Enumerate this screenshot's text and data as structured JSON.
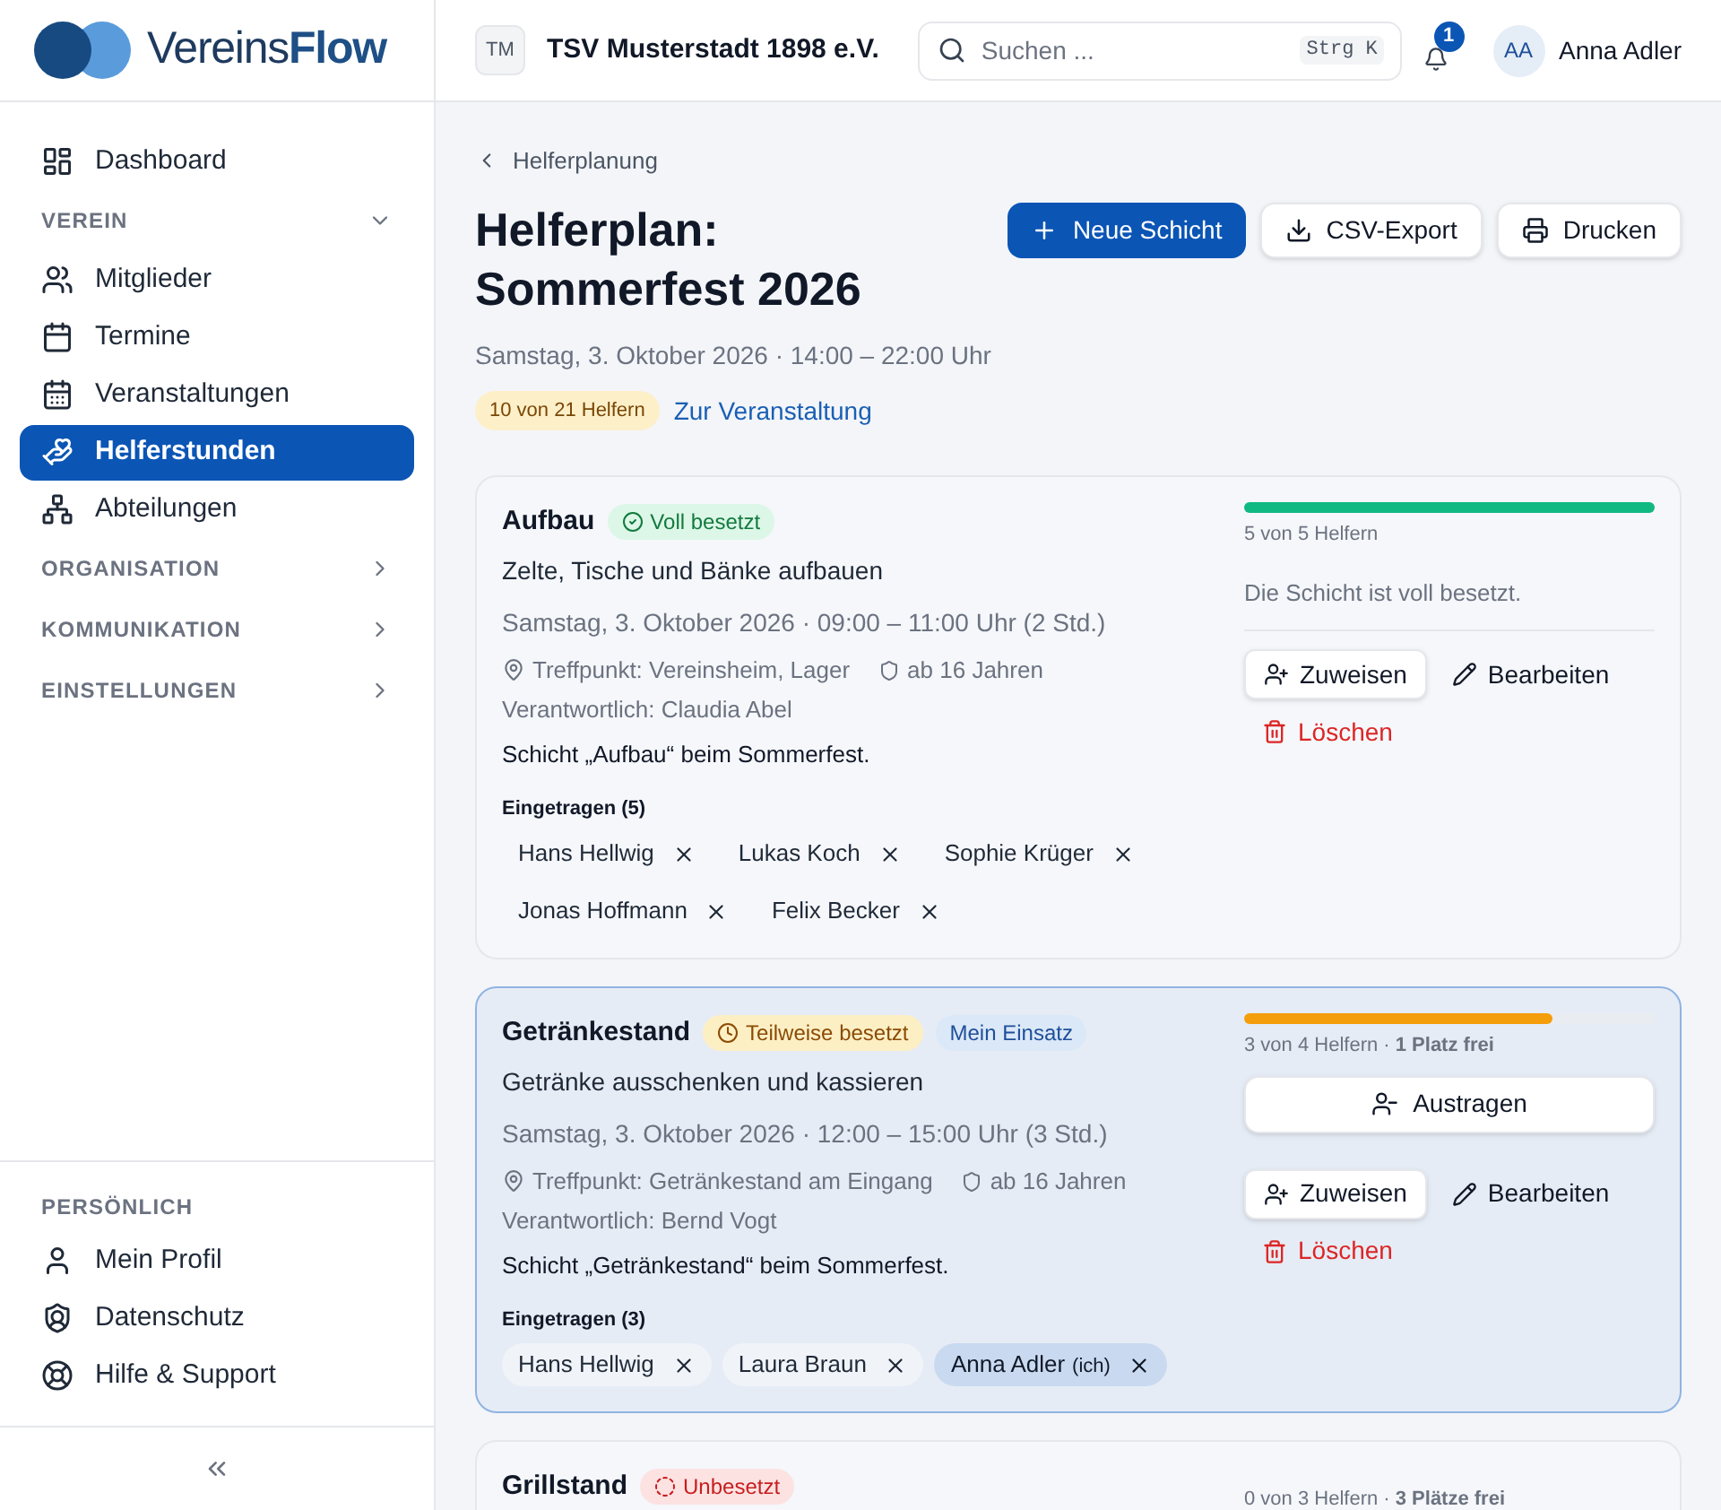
{
  "brand": {
    "name_light": "Vereins",
    "name_bold": "Flow"
  },
  "sidebar": {
    "items": [
      {
        "kind": "item",
        "label": "Dashboard",
        "selected": false
      },
      {
        "kind": "section",
        "label": "VEREIN",
        "expanded": true
      },
      {
        "kind": "item",
        "label": "Mitglieder",
        "selected": false
      },
      {
        "kind": "item",
        "label": "Termine",
        "selected": false
      },
      {
        "kind": "item",
        "label": "Veranstaltungen",
        "selected": false
      },
      {
        "kind": "item",
        "label": "Helferstunden",
        "selected": true
      },
      {
        "kind": "item",
        "label": "Abteilungen",
        "selected": false
      },
      {
        "kind": "section",
        "label": "ORGANISATION",
        "expanded": false
      },
      {
        "kind": "section",
        "label": "KOMMUNIKATION",
        "expanded": false
      },
      {
        "kind": "section",
        "label": "EINSTELLUNGEN",
        "expanded": false
      }
    ],
    "personal": {
      "heading": "PERSÖNLICH",
      "items": [
        {
          "label": "Mein Profil"
        },
        {
          "label": "Datenschutz"
        },
        {
          "label": "Hilfe & Support"
        }
      ]
    }
  },
  "header": {
    "org_initials": "TM",
    "org_name": "TSV Musterstadt 1898 e.V.",
    "search": {
      "placeholder": "Suchen ...",
      "shortcut": "Strg K"
    },
    "notifications": "1",
    "user": {
      "initials": "AA",
      "name": "Anna Adler"
    }
  },
  "page": {
    "breadcrumb": "Helferplanung",
    "title_line1": "Helferplan:",
    "title_line2": "Sommerfest 2026",
    "date": "Samstag, 3. Oktober 2026 · 14:00 – 22:00 Uhr",
    "count_badge": "10 von 21 Helfern",
    "event_link": "Zur Veranstaltung",
    "buttons": [
      {
        "kind": "primary",
        "label": "Neue Schicht"
      },
      {
        "kind": "export",
        "label": "CSV-Export"
      },
      {
        "kind": "print",
        "label": "Drucken"
      }
    ]
  },
  "shifts": [
    {
      "title": "Aufbau",
      "status": {
        "kind": "full",
        "label": "Voll besetzt"
      },
      "selected": false,
      "subtitle": "Zelte, Tische und Bänke aufbauen",
      "datetime": "Samstag, 3. Oktober 2026 · 09:00 – 11:00 Uhr (2 Std.)",
      "location": "Treffpunkt: Vereinsheim, Lager",
      "age": "ab 16 Jahren",
      "responsible": "Verantwortlich: Claudia Abel",
      "description": "Schicht „Aufbau“ beim Sommerfest.",
      "registered_label": "Eingetragen (5)",
      "members": [
        {
          "name": "Hans Hellwig",
          "self": false
        },
        {
          "name": "Lukas Koch",
          "self": false
        },
        {
          "name": "Sophie Krüger",
          "self": false
        },
        {
          "name": "Jonas Hoffmann",
          "self": false
        },
        {
          "name": "Felix Becker",
          "self": false
        }
      ],
      "progress": {
        "level": 1,
        "text": "5 von 5 Helfern"
      },
      "note": "Die Schicht ist voll besetzt.",
      "actions": [
        {
          "kind": "assign",
          "label": "Zuweisen"
        },
        {
          "kind": "edit",
          "label": "Bearbeiten"
        },
        {
          "kind": "delete",
          "label": "Löschen"
        }
      ]
    },
    {
      "title": "Getränkestand",
      "status": {
        "kind": "partial",
        "label": "Teilweise besetzt"
      },
      "tag": "Mein Einsatz",
      "selected": true,
      "subtitle": "Getränke ausschenken und kassieren",
      "datetime": "Samstag, 3. Oktober 2026 · 12:00 – 15:00 Uhr (3 Std.)",
      "location": "Treffpunkt: Getränkestand am Eingang",
      "age": "ab 16 Jahren",
      "responsible": "Verantwortlich: Bernd Vogt",
      "description": "Schicht „Getränkestand“ beim Sommerfest.",
      "registered_label": "Eingetragen (3)",
      "members": [
        {
          "name": "Hans Hellwig",
          "self": false
        },
        {
          "name": "Laura Braun",
          "self": false
        },
        {
          "name": "Anna Adler",
          "suffix": "(ich)",
          "self": true
        }
      ],
      "progress": {
        "level": 0.75,
        "text": "3 von 4 Helfern · **1 Platz frei**"
      },
      "actions": [
        {
          "kind": "unassign",
          "label": "Austragen"
        },
        {
          "kind": "assign",
          "label": "Zuweisen"
        },
        {
          "kind": "edit",
          "label": "Bearbeiten"
        },
        {
          "kind": "delete",
          "label": "Löschen"
        }
      ]
    },
    {
      "title": "Grillstand",
      "status": {
        "kind": "empty",
        "label": "Unbesetzt"
      },
      "selected": false,
      "progress": {
        "text": "0 von 3 Helfern · **3 Plätze frei**"
      }
    }
  ]
}
